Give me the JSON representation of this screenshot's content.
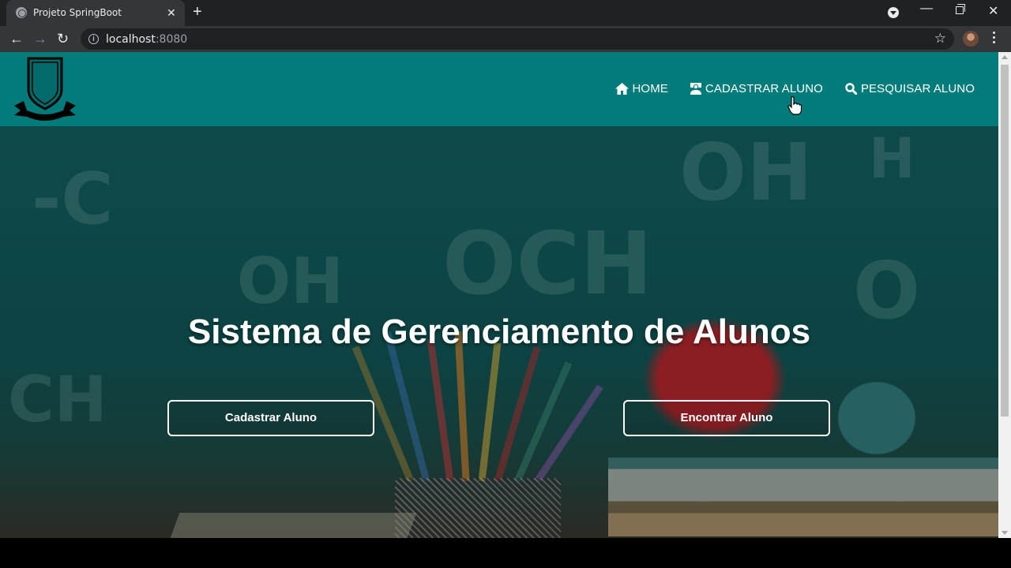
{
  "browser": {
    "tab_title": "Projeto SpringBoot",
    "tab_close": "✕",
    "new_tab": "+",
    "url_host": "localhost",
    "url_port": ":8080",
    "window_min": "—",
    "window_close": "✕"
  },
  "site": {
    "nav": [
      {
        "label": "HOME",
        "icon": "home-icon"
      },
      {
        "label": "CADASTRAR ALUNO",
        "icon": "user-card-icon"
      },
      {
        "label": "PESQUISAR ALUNO",
        "icon": "search-icon"
      }
    ],
    "colors": {
      "header": "#027b7b",
      "hero_overlay": "#0c4343"
    }
  },
  "hero": {
    "title": "Sistema de Gerenciamento de Alunos",
    "button_left": "Cadastrar Aluno",
    "button_right": "Encontrar Aluno"
  }
}
